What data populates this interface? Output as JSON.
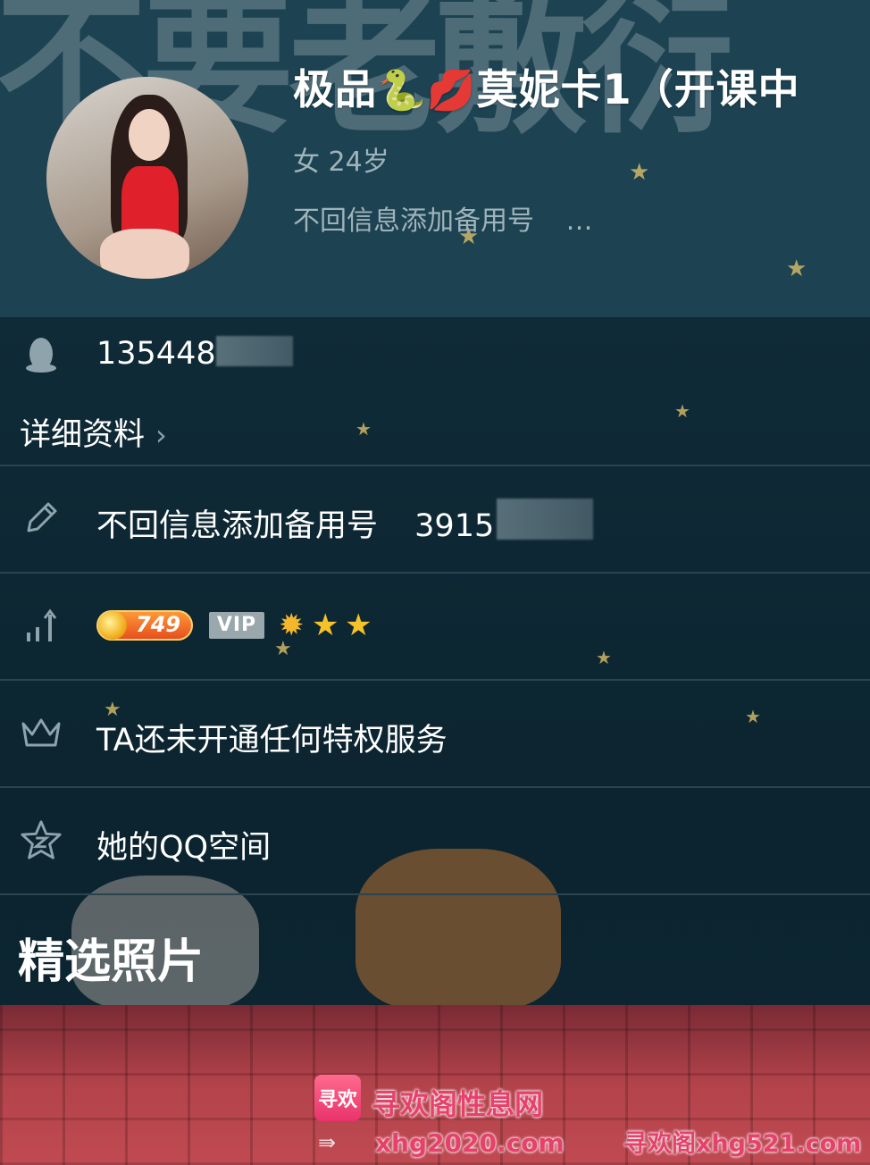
{
  "background_text": "不要老敷衍",
  "profile": {
    "nickname_part1": "极品",
    "emoji_snake": "🐍",
    "emoji_lips": "💋",
    "nickname_part2": "莫妮卡1（开课中",
    "gender_age": "女 24岁",
    "signature": "不回信息添加备用号",
    "signature_more": "…"
  },
  "qq_row": {
    "icon": "qq-penguin-icon",
    "number_visible": "135448"
  },
  "detail_link": {
    "label": "详细资料",
    "chevron": "›"
  },
  "signature_row": {
    "icon": "pencil-icon",
    "text": "不回信息添加备用号",
    "number_visible": "3915"
  },
  "level_row": {
    "icon": "level-bars-icon",
    "coin_value": "749",
    "vip_label": "VIP",
    "level_icons": [
      "sun",
      "star",
      "star"
    ]
  },
  "privilege_row": {
    "icon": "crown-icon",
    "text": "TA还未开通任何特权服务"
  },
  "qzone_row": {
    "icon": "qzone-star-icon",
    "text": "她的QQ空间"
  },
  "section": {
    "title": "精选照片"
  },
  "watermarks": {
    "logo_text": "寻欢",
    "site_name": "寻欢阁性息网",
    "url": "xhg2020.com",
    "right": "寻欢阁xhg521.com"
  },
  "colors": {
    "header_bg": "#1d4252",
    "main_bg": "#0d2530",
    "divider": "#2a4450",
    "icon_gray": "#8ea3ab",
    "accent_pink": "#e5416b"
  }
}
